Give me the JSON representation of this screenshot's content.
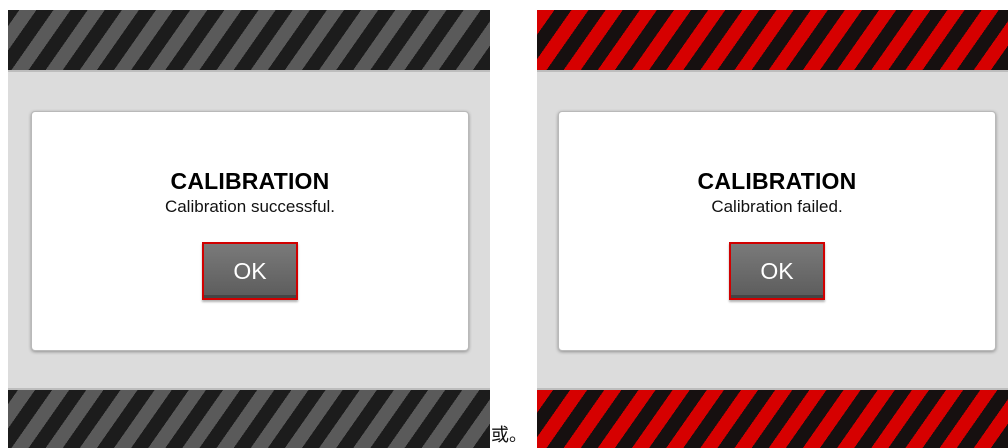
{
  "screens": [
    {
      "state": "success",
      "stripe_colors": [
        "#1c1c1c",
        "#5a5a5a"
      ],
      "dialog": {
        "title": "CALIBRATION",
        "message": "Calibration successful.",
        "ok_label": "OK"
      }
    },
    {
      "state": "failure",
      "stripe_colors": [
        "#161010",
        "#d60000"
      ],
      "dialog": {
        "title": "CALIBRATION",
        "message": "Calibration failed.",
        "ok_label": "OK"
      }
    }
  ],
  "separator_text": "或。",
  "colors": {
    "button_border": "#d10000",
    "button_fill": "#6b6b6b",
    "panel_background": "#dcdcdc",
    "dialog_background": "#ffffff"
  }
}
